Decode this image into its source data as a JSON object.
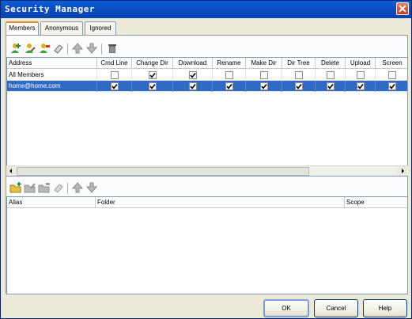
{
  "window": {
    "title": "Security Manager"
  },
  "tabs": [
    {
      "label": "Members",
      "active": true
    },
    {
      "label": "Anonymous",
      "active": false
    },
    {
      "label": "Ignored",
      "active": false
    }
  ],
  "members_toolbar": {
    "icons": [
      "add-user-icon",
      "edit-user-icon",
      "user-properties-icon",
      "eraser-icon",
      "move-up-icon",
      "move-down-icon",
      "trash-icon"
    ]
  },
  "members_table": {
    "columns": [
      "Address",
      "Cmd Line",
      "Change Dir",
      "Download",
      "Rename",
      "Make Dir",
      "Dir Tree",
      "Delete",
      "Upload",
      "Screen"
    ],
    "rows": [
      {
        "address": "All Members",
        "selected": false,
        "perms": [
          false,
          true,
          true,
          false,
          false,
          false,
          false,
          false,
          false
        ]
      },
      {
        "address": "home@home.com",
        "selected": true,
        "perms": [
          true,
          true,
          true,
          true,
          true,
          true,
          true,
          true,
          true
        ]
      }
    ]
  },
  "folders_toolbar": {
    "icons": [
      "add-folder-icon",
      "edit-folder-icon",
      "folder-properties-icon",
      "eraser-icon",
      "move-up-icon",
      "move-down-icon"
    ]
  },
  "folders_table": {
    "columns": [
      "Alias",
      "Folder",
      "Scope"
    ],
    "rows": []
  },
  "buttons": {
    "ok": "OK",
    "cancel": "Cancel",
    "help": "Help"
  },
  "colors": {
    "title_bar": "#0a4fc2",
    "selection": "#316ac5",
    "dialog_bg": "#ece9d8",
    "icon_green": "#3aa43a",
    "icon_gold": "#e0b020"
  }
}
